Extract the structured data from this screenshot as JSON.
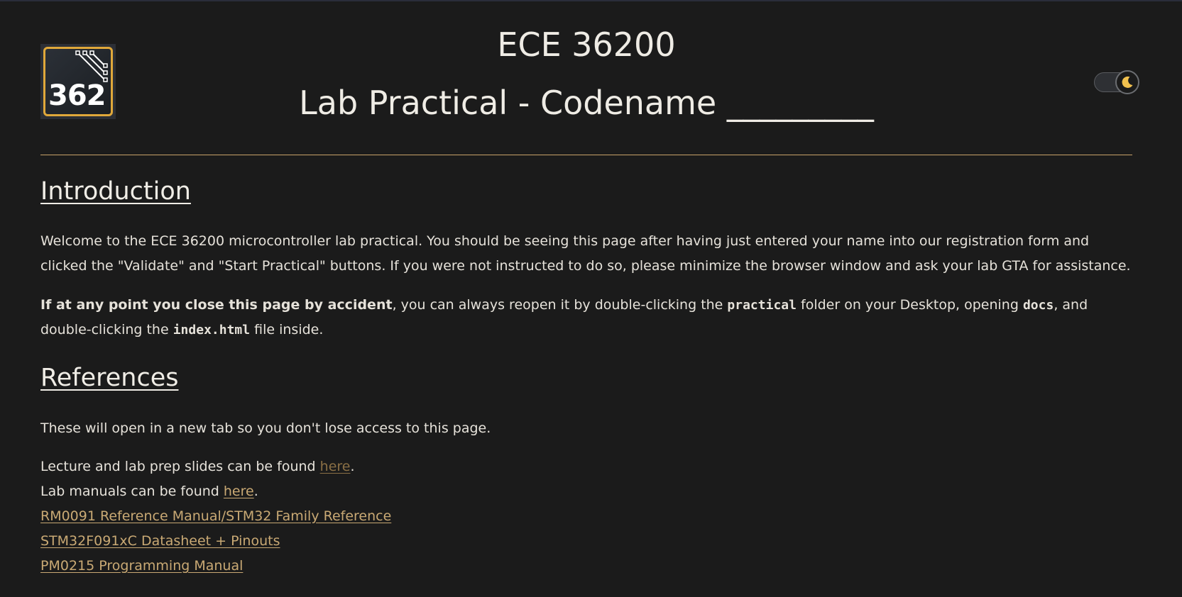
{
  "header": {
    "logo_text": "362",
    "course_title": "ECE 36200",
    "lab_title": "Lab Practical - Codename _________",
    "theme_toggle_icon": "moon-icon"
  },
  "colors": {
    "background": "#1b1b1b",
    "accent": "#c9a974",
    "visited_link": "#8b7045",
    "logo_border": "#e0a83a"
  },
  "introduction": {
    "heading": "Introduction",
    "para1": "Welcome to the ECE 36200 microcontroller lab practical. You should be seeing this page after having just entered your name into our registration form and clicked the \"Validate\" and \"Start Practical\" buttons. If you were not instructed to do so, please minimize the browser window and ask your lab GTA for assistance.",
    "para2_bold": "If at any point you close this page by accident",
    "para2_a": ", you can always reopen it by double-clicking the ",
    "para2_code1": "practical",
    "para2_b": " folder on your Desktop, opening ",
    "para2_code2": "docs",
    "para2_c": ", and double-clicking the ",
    "para2_code3": "index.html",
    "para2_d": " file inside."
  },
  "references": {
    "heading": "References",
    "note": "These will open in a new tab so you don't lose access to this page.",
    "slides_prefix": "Lecture and lab prep slides can be found ",
    "slides_link": "here",
    "slides_suffix": ".",
    "manuals_prefix": "Lab manuals can be found ",
    "manuals_link": "here",
    "manuals_suffix": ".",
    "links": [
      "RM0091 Reference Manual/STM32 Family Reference",
      "STM32F091xC Datasheet + Pinouts",
      "PM0215 Programming Manual"
    ]
  }
}
